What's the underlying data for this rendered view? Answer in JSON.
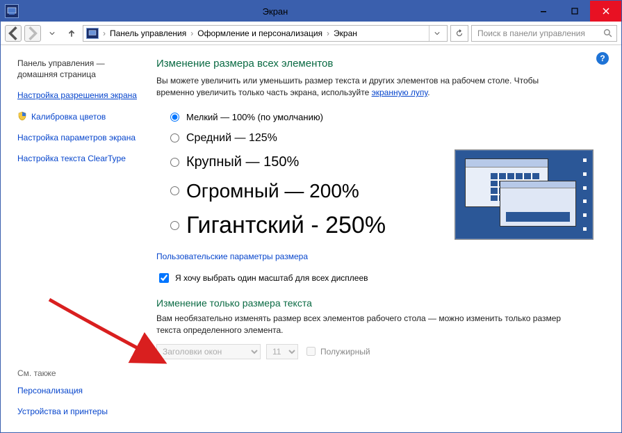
{
  "window": {
    "title": "Экран"
  },
  "breadcrumb": {
    "root": "Панель управления",
    "mid": "Оформление и персонализация",
    "leaf": "Экран"
  },
  "search": {
    "placeholder": "Поиск в панели управления"
  },
  "sidebar": {
    "home": "Панель управления — домашняя страница",
    "resolution": "Настройка разрешения экрана",
    "calibration": "Калибровка цветов",
    "params": "Настройка параметров экрана",
    "cleartype": "Настройка текста ClearType",
    "see_also": "См. также",
    "personalization": "Персонализация",
    "devices": "Устройства и принтеры"
  },
  "main": {
    "heading1": "Изменение размера всех элементов",
    "desc_part1": "Вы можете увеличить или уменьшить размер текста и других элементов на рабочем столе. Чтобы временно увеличить только часть экрана, используйте ",
    "desc_link": "экранную лупу",
    "desc_part2": ".",
    "options": {
      "small": "Мелкий — 100% (по умолчанию)",
      "medium": "Средний — 125%",
      "large": "Крупный — 150%",
      "huge": "Огромный — 200%",
      "giant": "Гигантский - 250%"
    },
    "custom_link": "Пользовательские параметры размера",
    "checkbox": "Я хочу выбрать один масштаб для всех дисплеев",
    "heading2": "Изменение только размера текста",
    "desc2": "Вам необязательно изменять размер всех элементов рабочего стола — можно изменить только размер текста определенного элемента.",
    "select1": "Заголовки окон",
    "select2": "11",
    "bold": "Полужирный"
  }
}
